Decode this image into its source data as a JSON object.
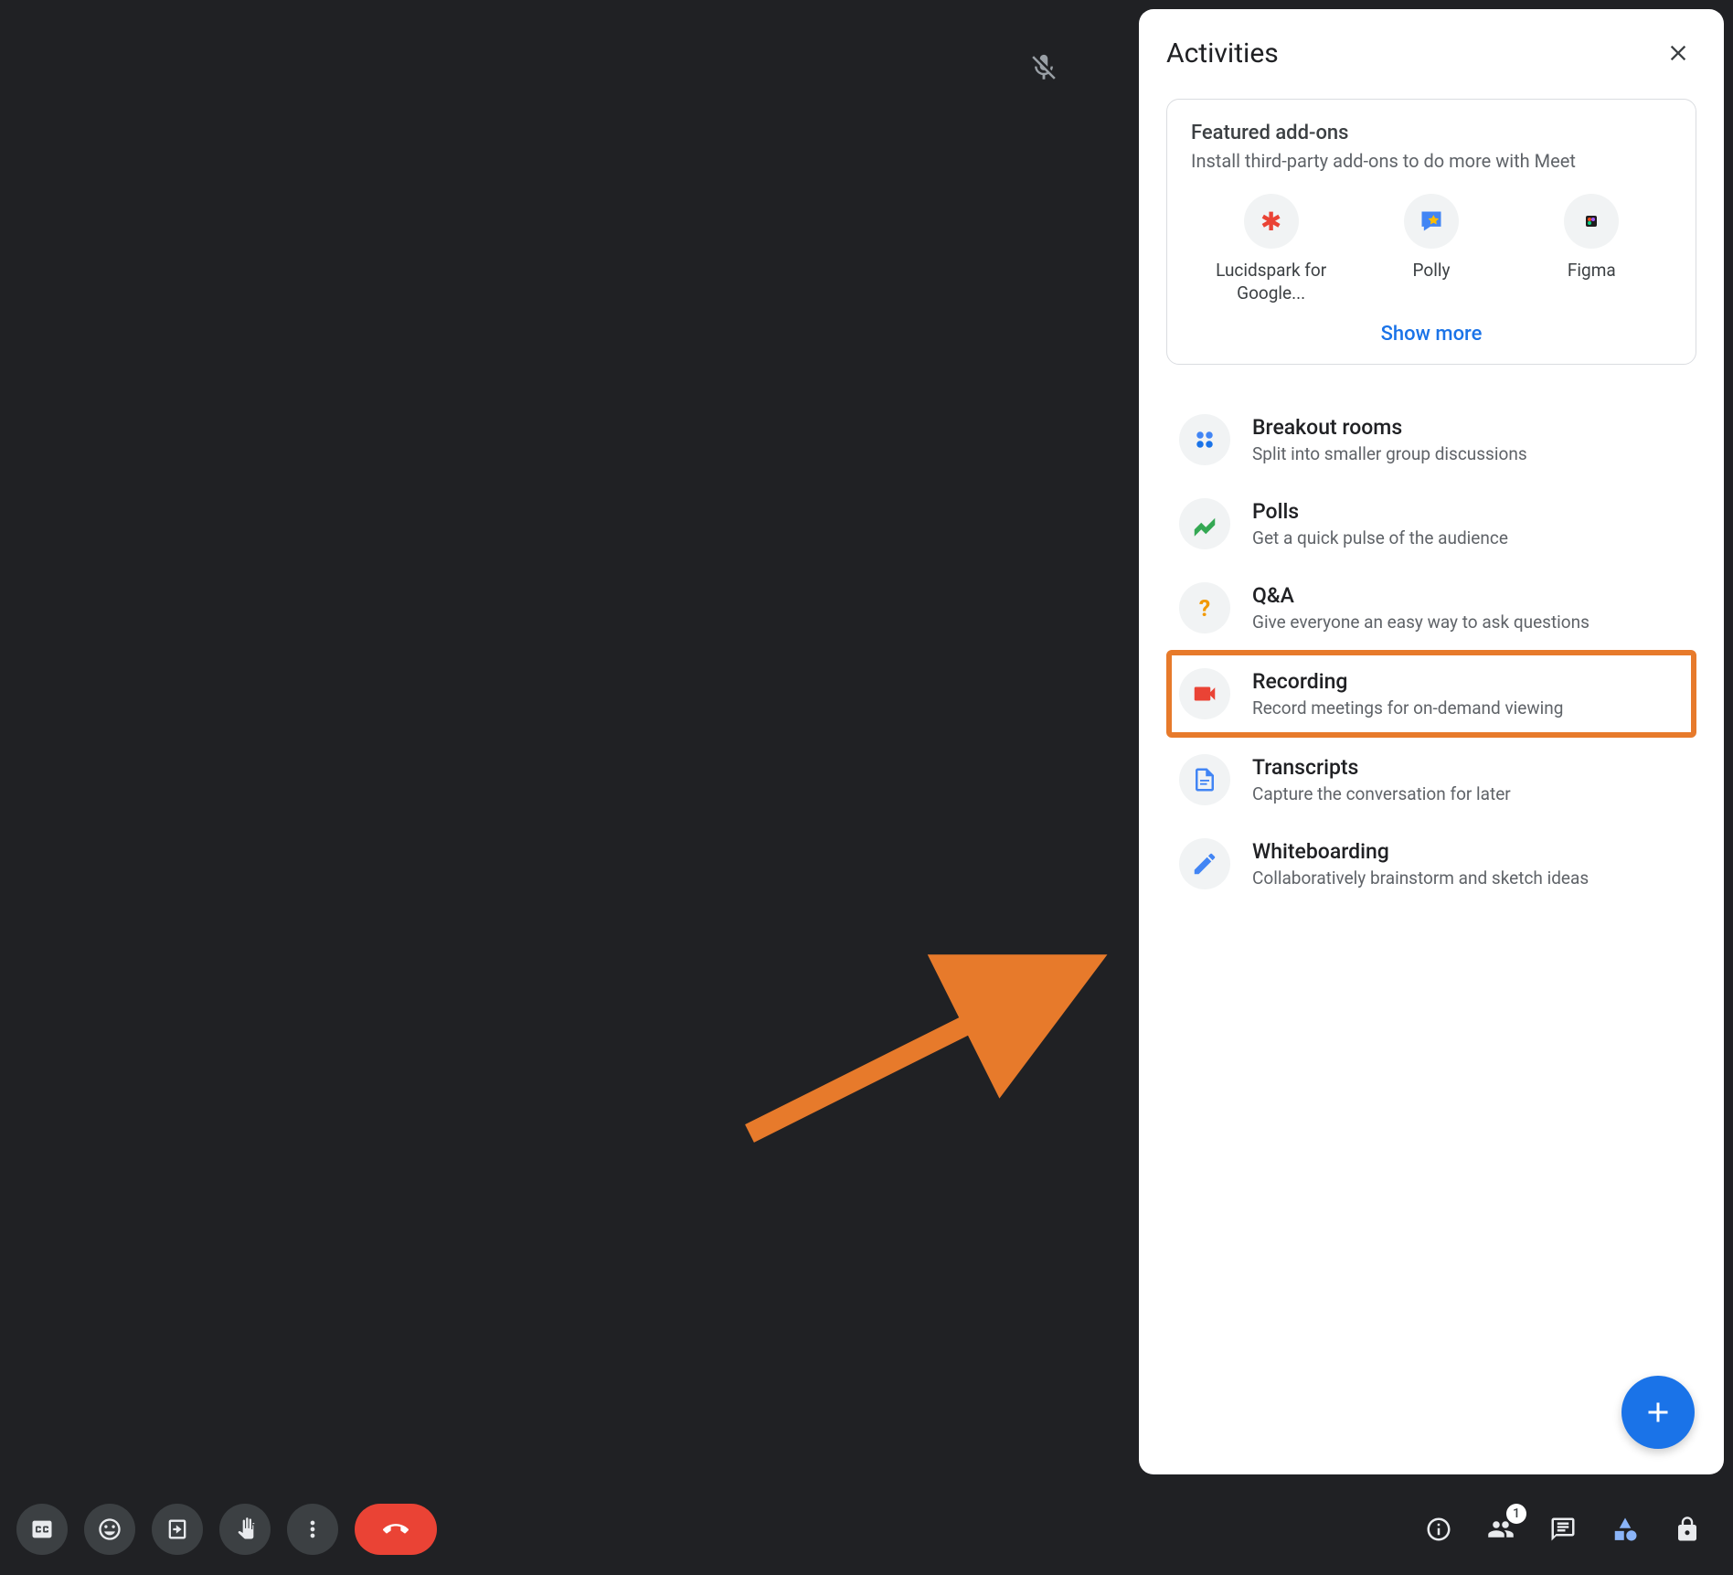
{
  "panel": {
    "title": "Activities",
    "close_label": "Close",
    "featured": {
      "heading": "Featured add-ons",
      "sub": "Install third-party add-ons to do more with Meet",
      "addons": [
        {
          "label": "Lucidspark for Google...",
          "icon_color": "#ea4335"
        },
        {
          "label": "Polly",
          "icon_color": "#4285f4"
        },
        {
          "label": "Figma",
          "icon_color": "#a142f4"
        }
      ],
      "show_more": "Show more"
    },
    "activities": [
      {
        "title": "Breakout rooms",
        "desc": "Split into smaller group discussions",
        "icon": "breakout",
        "highlighted": false
      },
      {
        "title": "Polls",
        "desc": "Get a quick pulse of the audience",
        "icon": "polls",
        "highlighted": false
      },
      {
        "title": "Q&A",
        "desc": "Give everyone an easy way to ask questions",
        "icon": "qa",
        "highlighted": false
      },
      {
        "title": "Recording",
        "desc": "Record meetings for on-demand viewing",
        "icon": "recording",
        "highlighted": true
      },
      {
        "title": "Transcripts",
        "desc": "Capture the conversation for later",
        "icon": "transcripts",
        "highlighted": false
      },
      {
        "title": "Whiteboarding",
        "desc": "Collaboratively brainstorm and sketch ideas",
        "icon": "whiteboard",
        "highlighted": false
      }
    ]
  },
  "bottom": {
    "participant_count": "1"
  }
}
